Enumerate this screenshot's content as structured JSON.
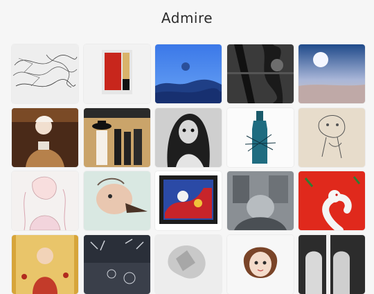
{
  "app": {
    "title": "Admire"
  },
  "gallery": {
    "items": [
      {
        "name": "artwork-tile-line-sketch"
      },
      {
        "name": "artwork-tile-red-panel"
      },
      {
        "name": "artwork-tile-blue-landscape"
      },
      {
        "name": "artwork-tile-dark-abstract"
      },
      {
        "name": "artwork-tile-moon-sky"
      },
      {
        "name": "artwork-tile-fur-portrait"
      },
      {
        "name": "artwork-tile-figures-hats"
      },
      {
        "name": "artwork-tile-bw-girl"
      },
      {
        "name": "artwork-tile-bottle-drawing"
      },
      {
        "name": "artwork-tile-creature-sketch"
      },
      {
        "name": "artwork-tile-pastel-figure"
      },
      {
        "name": "artwork-tile-bird-head"
      },
      {
        "name": "artwork-tile-framed-abstract"
      },
      {
        "name": "artwork-tile-grey-scene"
      },
      {
        "name": "artwork-tile-red-serpent"
      },
      {
        "name": "artwork-tile-floral-woman"
      },
      {
        "name": "artwork-tile-dark-pattern"
      },
      {
        "name": "artwork-tile-grey-texture"
      },
      {
        "name": "artwork-tile-anime-girl"
      },
      {
        "name": "artwork-tile-arches-bw"
      }
    ]
  }
}
